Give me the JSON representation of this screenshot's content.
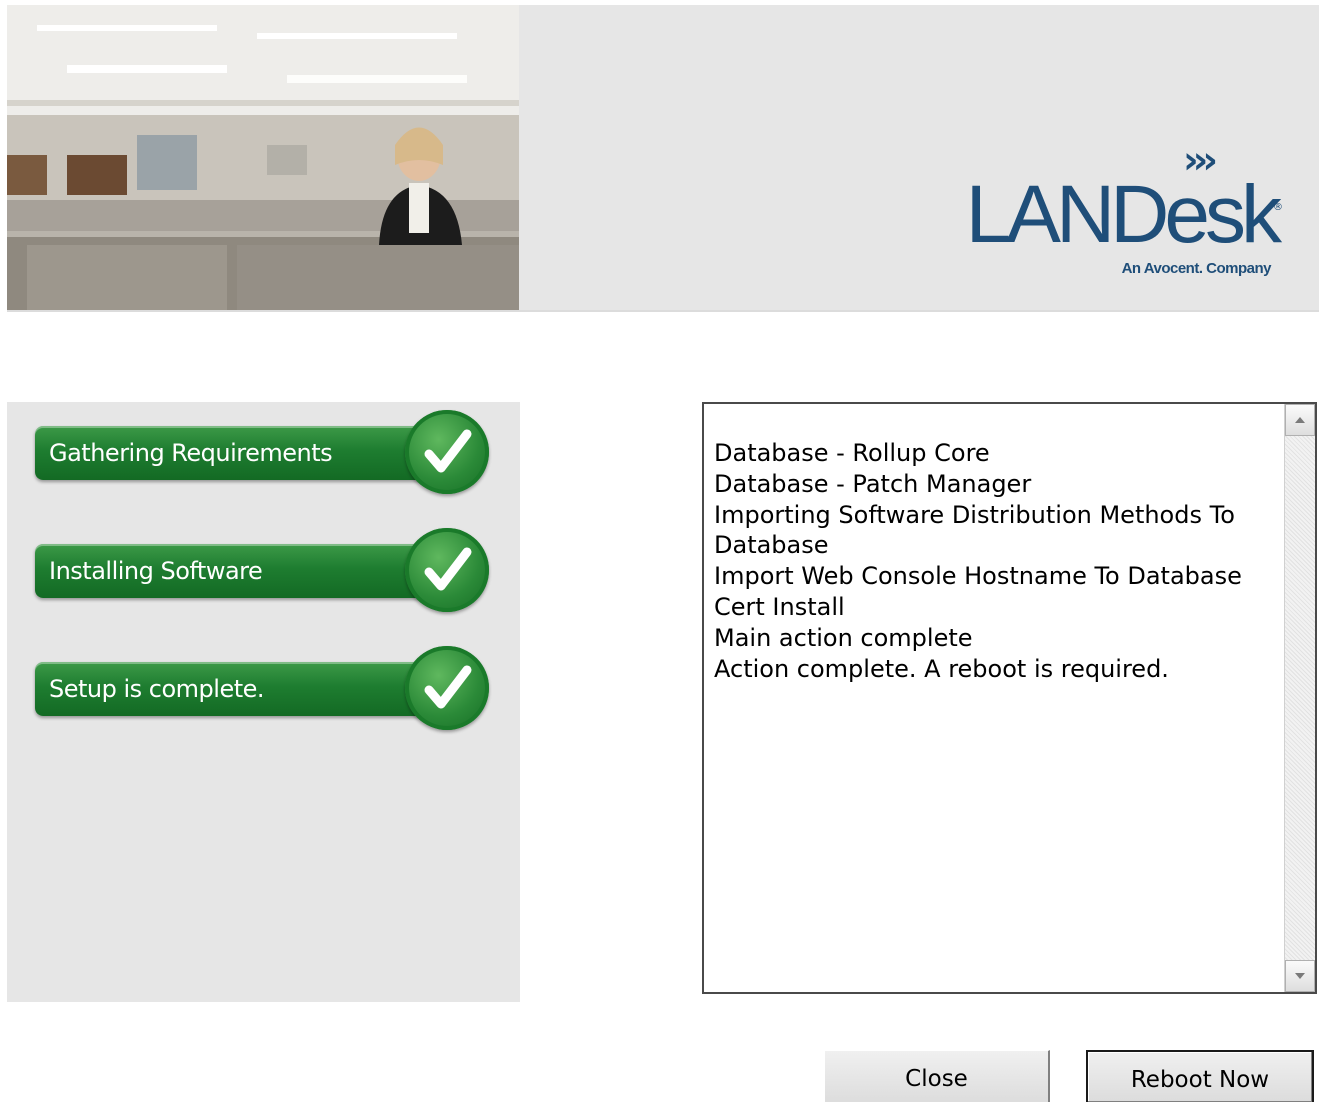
{
  "header": {
    "logo": {
      "chevrons": "›››",
      "wordmark": "LANDesk",
      "registered": "®",
      "tagline": "An Avocent. Company"
    },
    "photo_description_icon": "office-photo"
  },
  "steps": [
    {
      "label": "Gathering Requirements",
      "status": "complete",
      "icon": "checkmark-icon"
    },
    {
      "label": "Installing Software",
      "status": "complete",
      "icon": "checkmark-icon"
    },
    {
      "label": "Setup is complete.",
      "status": "complete",
      "icon": "checkmark-icon"
    }
  ],
  "log": {
    "lines": [
      "Database - Rollup Core",
      "Database - Patch Manager",
      "Importing Software Distribution Methods To Database",
      "Import Web Console Hostname To Database",
      "Cert Install",
      "Main action complete",
      "Action complete. A reboot is required."
    ]
  },
  "buttons": {
    "close": "Close",
    "reboot": "Reboot Now"
  },
  "colors": {
    "brand_blue": "#1f4e79",
    "step_green": "#1e7d30",
    "panel_gray": "#e6e6e6"
  }
}
